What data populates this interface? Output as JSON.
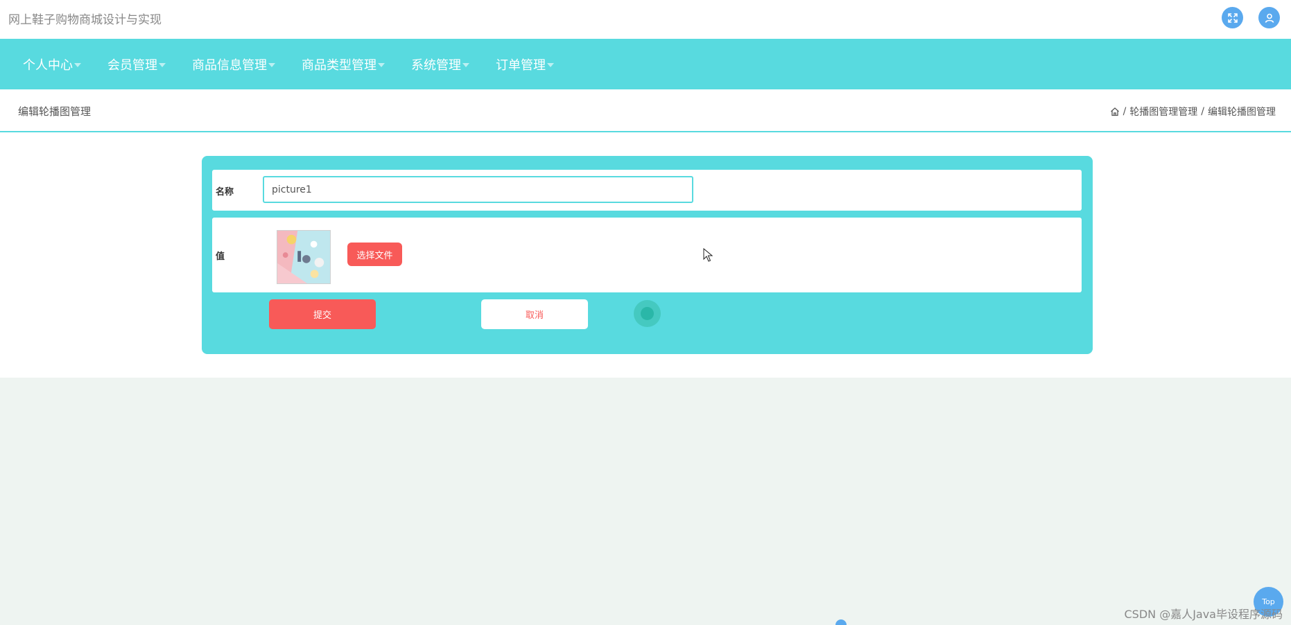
{
  "header": {
    "title": "网上鞋子购物商城设计与实现",
    "icons": [
      "fullscreen-icon",
      "user-icon"
    ]
  },
  "nav": {
    "items": [
      {
        "label": "个人中心"
      },
      {
        "label": "会员管理"
      },
      {
        "label": "商品信息管理"
      },
      {
        "label": "商品类型管理"
      },
      {
        "label": "系统管理"
      },
      {
        "label": "订单管理"
      }
    ]
  },
  "page": {
    "title": "编辑轮播图管理",
    "breadcrumb": {
      "separator": "/",
      "items": [
        "轮播图管理管理",
        "编辑轮播图管理"
      ]
    }
  },
  "form": {
    "name_label": "名称",
    "name_value": "picture1",
    "value_label": "值",
    "file_button": "选择文件",
    "submit": "提交",
    "cancel": "取消"
  },
  "footer": {
    "top_button": "Top",
    "watermark": "CSDN @嘉人Java毕设程序源码"
  },
  "colors": {
    "accent": "#58dadf",
    "danger": "#f85a58",
    "icon_blue": "#5aa9ee",
    "page_bg": "#eef4f1"
  }
}
